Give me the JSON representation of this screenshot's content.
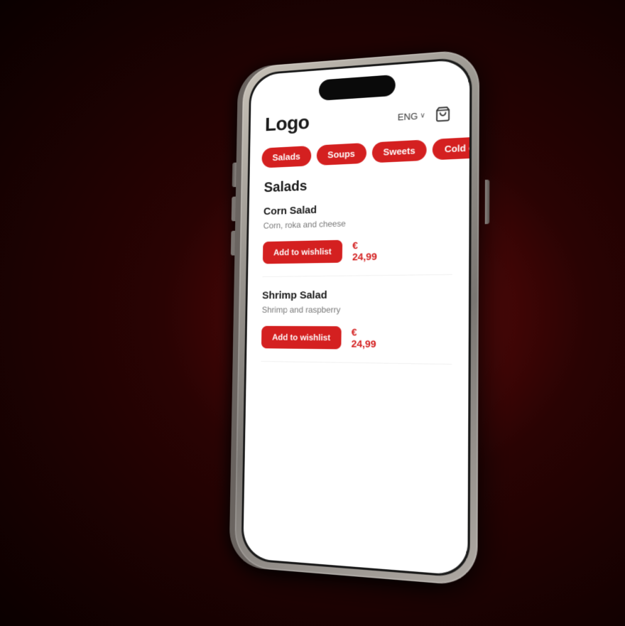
{
  "header": {
    "logo": "Logo",
    "language": "ENG",
    "chevron": "∨"
  },
  "categories": [
    {
      "id": "salads",
      "label": "Salads"
    },
    {
      "id": "soups",
      "label": "Soups"
    },
    {
      "id": "sweets",
      "label": "Sweets"
    },
    {
      "id": "cold-drinks",
      "label": "Cold drinks"
    }
  ],
  "section": {
    "title": "Salads"
  },
  "menu_items": [
    {
      "name": "Corn Salad",
      "description": "Corn, roka and cheese",
      "price": "€ 24,99",
      "button_label": "Add to wishlist",
      "image_type": "salad1"
    },
    {
      "name": "Shrimp Salad",
      "description": "Shrimp and raspberry",
      "price": "€ 24,99",
      "button_label": "Add to wishlist",
      "image_type": "salad2"
    }
  ],
  "colors": {
    "accent": "#d42020",
    "text_primary": "#1a1a1a",
    "text_secondary": "#777777"
  }
}
